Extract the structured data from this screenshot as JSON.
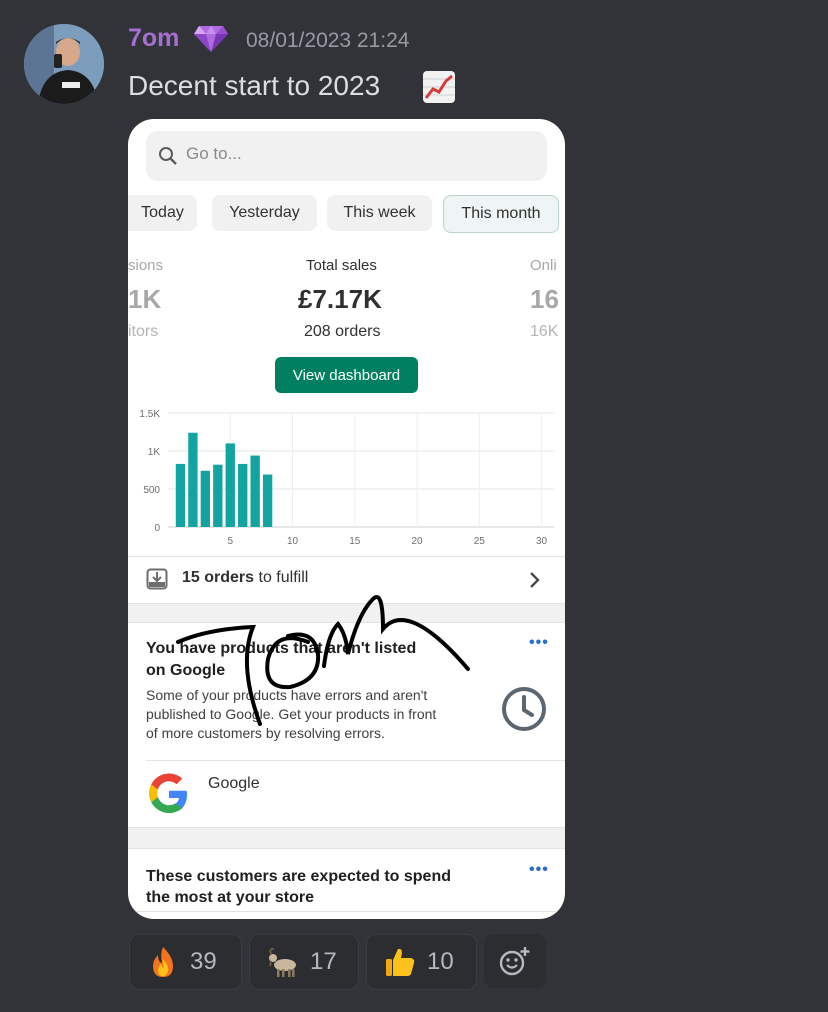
{
  "message": {
    "username": "7om",
    "badge_icon": "gem-icon",
    "timestamp": "08/01/2023 21:24",
    "text": "Decent start to 2023",
    "text_emoji": "chart-increasing-icon"
  },
  "screenshot": {
    "search": {
      "placeholder": "Go to..."
    },
    "tabs": [
      {
        "label": "Today",
        "active": false
      },
      {
        "label": "Yesterday",
        "active": false
      },
      {
        "label": "This week",
        "active": false
      },
      {
        "label": "This month",
        "active": true
      }
    ],
    "metrics": {
      "left": {
        "label": "sions",
        "value": "1K",
        "sub": "itors"
      },
      "center": {
        "label": "Total sales",
        "value": "£7.17K",
        "sub": "208 orders"
      },
      "right": {
        "label": "Onli",
        "value": "16",
        "sub": "16K"
      }
    },
    "dashboard_button": "View dashboard",
    "chart_data": {
      "type": "bar",
      "x": [
        1,
        2,
        3,
        4,
        5,
        6,
        7,
        8
      ],
      "values": [
        830,
        1240,
        740,
        820,
        1100,
        830,
        940,
        690
      ],
      "xlim": [
        0,
        31
      ],
      "ylim": [
        0,
        1500
      ],
      "x_ticks": [
        "5",
        "10",
        "15",
        "20",
        "25",
        "30"
      ],
      "y_ticks": [
        "1.5K",
        "1K",
        "500",
        "0"
      ],
      "bar_color": "#13a3a0",
      "grid": true
    },
    "orders": {
      "bold": "15 orders",
      "rest": "to fulfill"
    },
    "card1": {
      "title_line1": "You have products that aren't listed",
      "title_line2": "on Google",
      "body_line1": "Some of your products have errors and aren't",
      "body_line2": "published to Google. Get your products in front",
      "body_line3": "of more customers by resolving errors.",
      "app_name": "Google",
      "menu": "•••"
    },
    "card2": {
      "title_line1": "These customers are expected to spend",
      "title_line2": "the most at your store",
      "menu": "•••"
    },
    "watermark": "7OM"
  },
  "reactions": [
    {
      "icon": "fire-icon",
      "count": "39"
    },
    {
      "icon": "goat-icon",
      "count": "17"
    },
    {
      "icon": "thumbs-up-icon",
      "count": "10"
    }
  ],
  "add_reaction_icon": "add-reaction-icon",
  "colors": {
    "background": "#313338",
    "username": "#a36fd1",
    "shopify_green": "#008060"
  }
}
